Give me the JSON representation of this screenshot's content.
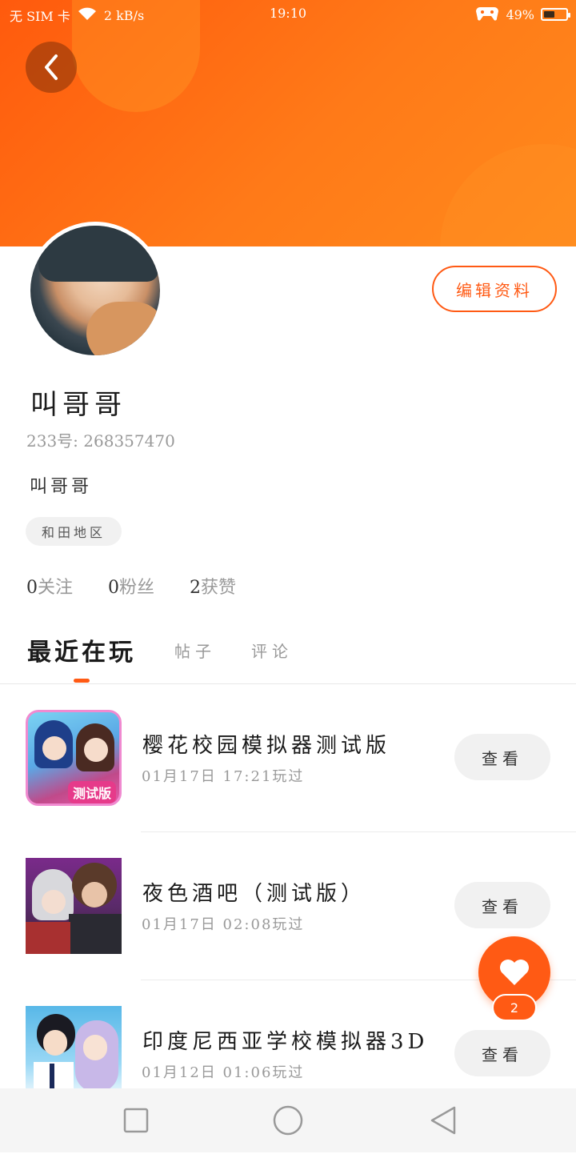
{
  "status_bar": {
    "carrier": "无 SIM 卡",
    "net_speed": "2 kB/s",
    "time": "19:10",
    "battery_percent": "49%",
    "battery_level": 0.49
  },
  "profile": {
    "edit_label": "编辑资料",
    "name": "叫哥哥",
    "id_text": "233号: 268357470",
    "bio": "叫哥哥",
    "location": "和田地区",
    "stats": [
      {
        "num": "0",
        "label": "关注"
      },
      {
        "num": "0",
        "label": "粉丝"
      },
      {
        "num": "2",
        "label": "获赞"
      }
    ]
  },
  "tabs": [
    "最近在玩",
    "帖子",
    "评论"
  ],
  "games": [
    {
      "title": "樱花校园模拟器测试版",
      "time": "01月17日 17:21玩过",
      "button": "查看",
      "icon_badge": "测试版"
    },
    {
      "title": "夜色酒吧（测试版）",
      "time": "01月17日 02:08玩过",
      "button": "查看"
    },
    {
      "title": "印度尼西亚学校模拟器3D",
      "time": "01月12日 01:06玩过",
      "button": "查看"
    }
  ],
  "like_count": "2",
  "colors": {
    "accent": "#ff5a14",
    "header": "#ff7a18"
  }
}
